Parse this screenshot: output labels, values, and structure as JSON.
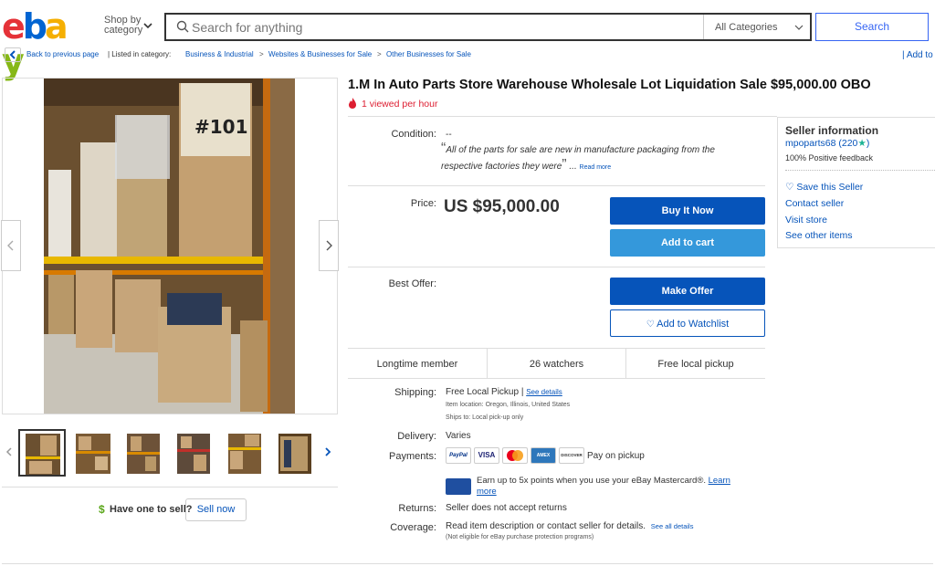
{
  "header": {
    "logo_letters": [
      "e",
      "b",
      "a",
      "y"
    ],
    "logo_colors": [
      "#e53238",
      "#0064d2",
      "#f5af02",
      "#86b817"
    ],
    "shop_by": "Shop by",
    "shop_by_2": "category",
    "search_placeholder": "Search for anything",
    "category": "All Categories",
    "search_label": "Search"
  },
  "breadcrumb": {
    "back": "Back to previous page",
    "listed_in": "| Listed in category:",
    "items": [
      "Business & Industrial",
      "Websites & Businesses for Sale",
      "Other Businesses for Sale"
    ],
    "sep": ">",
    "add_to": "| Add to"
  },
  "gallery": {
    "thumb_count": 6,
    "have_one": "Have one to sell?",
    "sell_now": "Sell now"
  },
  "item": {
    "title": "1.M In Auto Parts Store Warehouse Wholesale Lot Liquidation Sale $95,000.00 OBO",
    "viewed": "1 viewed per hour",
    "condition_label": "Condition:",
    "condition_value": "--",
    "quote": "All of the parts for sale are new in manufacture packaging from the respective factories they were",
    "quote_tail": "...",
    "read_more": "Read more",
    "price_label": "Price:",
    "price": "US $95,000.00",
    "buy_now": "Buy It Now",
    "add_to_cart": "Add to cart",
    "best_offer_label": "Best Offer:",
    "make_offer": "Make Offer",
    "add_watchlist": "Add to Watchlist",
    "stats": [
      "Longtime member",
      "26 watchers",
      "Free local pickup"
    ]
  },
  "details": {
    "shipping_label": "Shipping:",
    "shipping_value": "Free Local Pickup",
    "see_details": "See details",
    "item_location": "Item location:  Oregon, Illinois, United States",
    "ships_to": "Ships to:  Local pick-up only",
    "delivery_label": "Delivery:",
    "delivery_value": "Varies",
    "payments_label": "Payments:",
    "payment_cards": [
      "PayPal",
      "VISA",
      "MC",
      "AMEX",
      "DISCOVER"
    ],
    "pay_on_pickup": "Pay on pickup",
    "mastercard_promo": "Earn up to 5x points when you use your eBay Mastercard®.",
    "learn": "Learn",
    "more": "more",
    "returns_label": "Returns:",
    "returns_value": "Seller does not accept returns",
    "coverage_label": "Coverage:",
    "coverage_value": "Read item description or contact seller for details.",
    "see_all": "See all details",
    "coverage_note": "(Not eligible for eBay purchase protection programs)"
  },
  "seller": {
    "title": "Seller information",
    "name": "mpoparts68",
    "score": "(220",
    "score_close": ")",
    "feedback": "100% Positive feedback",
    "save": "Save this Seller",
    "contact": "Contact seller",
    "visit": "Visit store",
    "other": "See other items"
  },
  "colors": {
    "accent_blue": "#0654ba",
    "cart_blue": "#3498db",
    "flame_red": "#dd1e31"
  }
}
